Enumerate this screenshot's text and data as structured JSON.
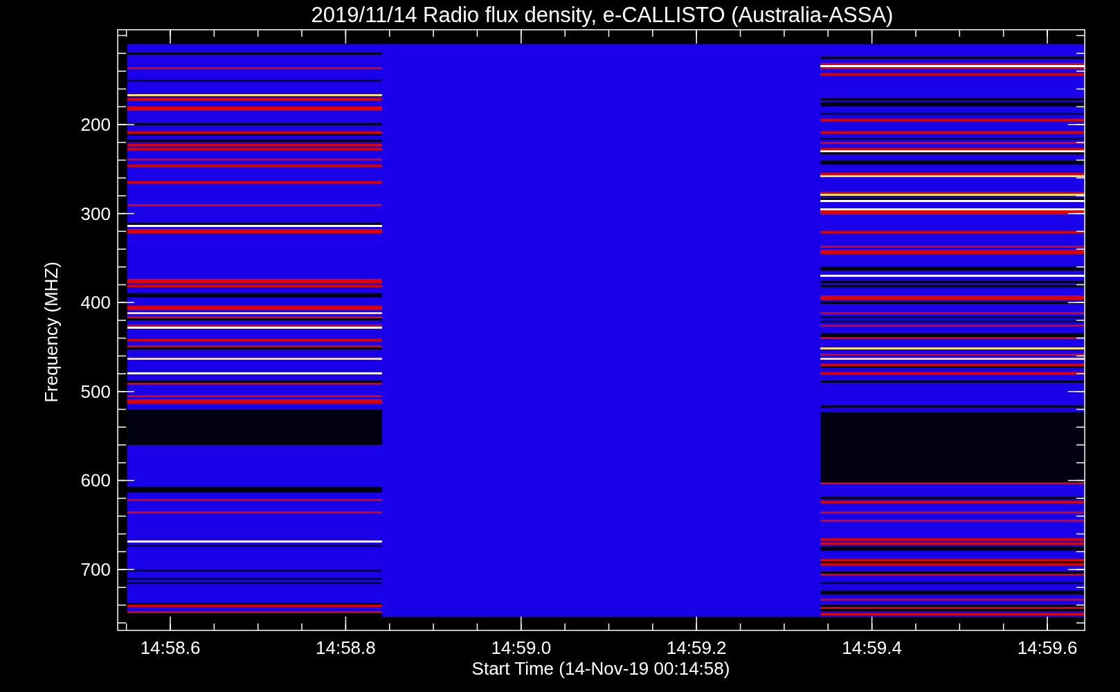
{
  "title": "2019/11/14  Radio flux density, e-CALLISTO (Australia-ASSA)",
  "ylabel": "Frequency (MHZ)",
  "xlabel": "Start Time (14-Nov-19 00:14:58)",
  "yticks": [
    "200",
    "300",
    "400",
    "500",
    "600",
    "700"
  ],
  "xticks": [
    "14:58.6",
    "14:58.8",
    "14:59.0",
    "14:59.2",
    "14:59.4",
    "14:59.6"
  ]
}
